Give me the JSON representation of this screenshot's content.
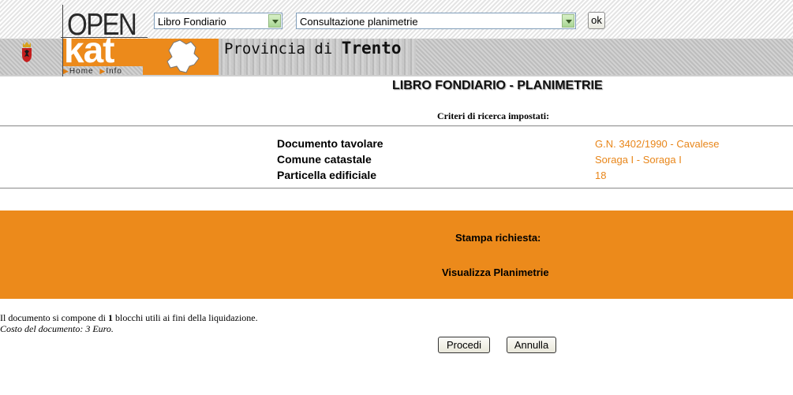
{
  "header": {
    "logo": {
      "line1": "OPEN",
      "line2": "kat"
    },
    "nav": [
      {
        "label": "Home"
      },
      {
        "label": "Info"
      }
    ],
    "province": {
      "prefix": "Provincia di ",
      "name": "Trento"
    },
    "area_select": {
      "value": "Libro Fondiario"
    },
    "function_select": {
      "value": "Consultazione planimetrie"
    },
    "ok_label": "ok"
  },
  "main": {
    "title": "LIBRO FONDIARIO - PLANIMETRIE",
    "criteria_label": "Criteri di ricerca impostati:",
    "criteria": [
      {
        "label": "Documento tavolare",
        "value": "G.N. 3402/1990 - Cavalese"
      },
      {
        "label": "Comune catastale",
        "value": "Soraga I - Soraga I"
      },
      {
        "label": "Particella edificiale",
        "value": "18"
      }
    ],
    "print_label": "Stampa richiesta:",
    "print_value": "Visualizza Planimetrie",
    "doc_info": {
      "prefix": "Il documento si compone di ",
      "blocks": "1",
      "suffix": " blocchi utili ai fini della liquidazione.",
      "cost": "Costo del documento: 3 Euro."
    },
    "buttons": {
      "proceed": "Procedi",
      "cancel": "Annulla"
    }
  },
  "colors": {
    "accent": "#ec8a1b",
    "value_text": "#e8861a"
  }
}
